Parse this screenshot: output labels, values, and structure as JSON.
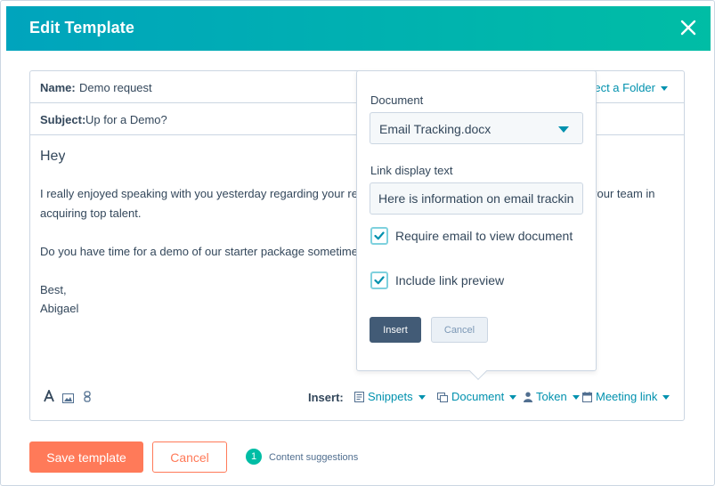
{
  "header": {
    "title": "Edit Template",
    "close_icon": "close-icon"
  },
  "editor": {
    "name_label": "Name:",
    "name_value": "Demo request",
    "folder_label": "ect a Folder",
    "subject_label": "Subject:",
    "subject_value": "Up for a Demo?",
    "body": {
      "greeting": "Hey",
      "para1_line1_start": "I really enjoyed speaking with you yesterday regarding your re",
      "para1_line1_end": "your team in",
      "para1_line2": "acquiring top talent.",
      "para2": "Do you have time for a demo of our starter package sometime",
      "signoff": "Best,",
      "signature": "Abigael"
    }
  },
  "toolbar": {
    "icons": [
      "text-format-icon",
      "image-icon",
      "attachment-icon"
    ],
    "insert_label": "Insert:",
    "snippets": "Snippets",
    "document": "Document",
    "token": "Token",
    "meeting": "Meeting link"
  },
  "popover": {
    "document_label": "Document",
    "document_value": "Email Tracking.docx",
    "link_label": "Link display text",
    "link_value": "Here is information on email tracking",
    "require_label": "Require email to view document",
    "require_checked": true,
    "preview_label": "Include link preview",
    "preview_checked": true,
    "insert_btn": "Insert",
    "cancel_btn": "Cancel"
  },
  "footer": {
    "save": "Save template",
    "cancel": "Cancel",
    "suggestions_count": "1",
    "suggestions_label": "Content suggestions"
  },
  "colors": {
    "accent": "#00a4bd",
    "accent2": "#00bda5",
    "primary_action": "#ff7a59",
    "link": "#0091ae",
    "text": "#33475b"
  }
}
